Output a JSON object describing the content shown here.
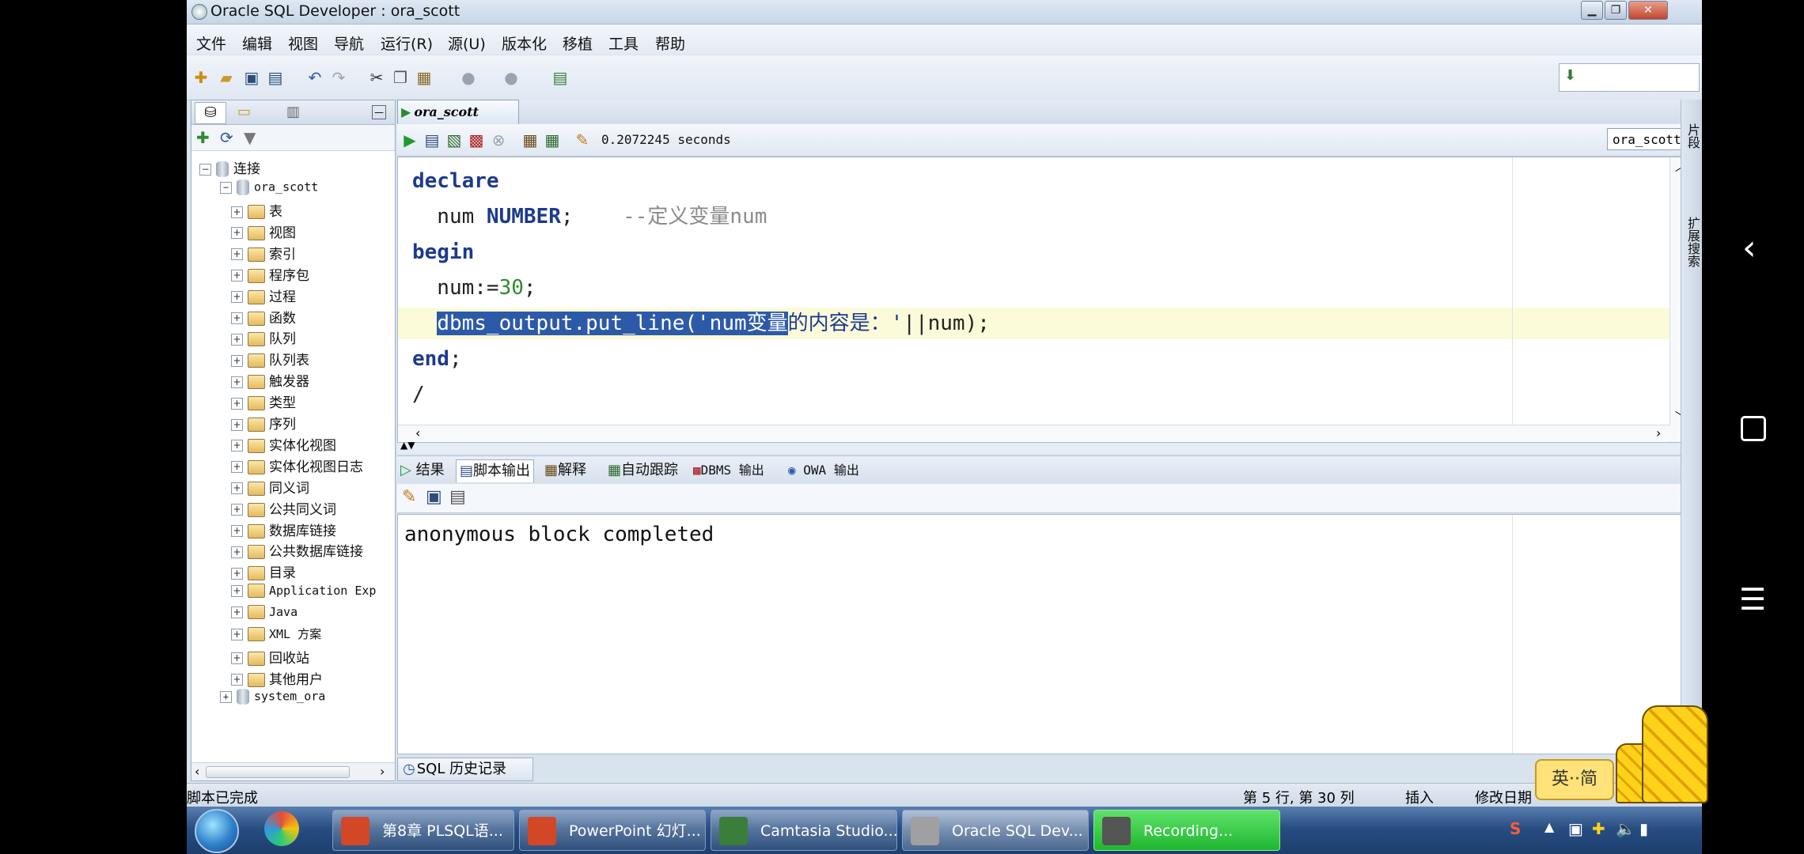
{
  "window": {
    "title": "Oracle SQL Developer : ora_scott"
  },
  "menu": [
    "文件",
    "编辑",
    "视图",
    "导航",
    "运行(R)",
    "源(U)",
    "版本化",
    "移植",
    "工具",
    "帮助"
  ],
  "tree": {
    "root": "连接",
    "connection": "ora_scott",
    "items": [
      "表",
      "视图",
      "索引",
      "程序包",
      "过程",
      "函数",
      "队列",
      "队列表",
      "触发器",
      "类型",
      "序列",
      "实体化视图",
      "实体化视图日志",
      "同义词",
      "公共同义词",
      "数据库链接",
      "公共数据库链接",
      "目录",
      "Application Exp",
      "Java",
      "XML 方案",
      "回收站",
      "其他用户"
    ],
    "other_connection": "system_ora"
  },
  "editor": {
    "tab_label": "ora_scott",
    "timing": "0.2072245 seconds",
    "connection_select": "ora_scott",
    "code": {
      "l1_kw": "declare",
      "l2_ident": "  num ",
      "l2_type": "NUMBER",
      "l2_semi": ";    ",
      "l2_comment": "--定义变量num",
      "l3_kw": "begin",
      "l4_ident": "  num:=",
      "l4_num": "30",
      "l4_semi": ";",
      "l5_indent": "  ",
      "l5_selected": "dbms_output.put_line('num变量",
      "l5_string_rest": "的内容是：'",
      "l5_rest": "||num);",
      "l6_kw": "end",
      "l6_semi": ";",
      "l7": "/"
    }
  },
  "output_tabs": [
    "结果",
    "脚本输出",
    "解释",
    "自动跟踪",
    "DBMS 输出",
    "OWA 输出"
  ],
  "output": {
    "text": "anonymous block completed"
  },
  "history_tab": "SQL 历史记录",
  "right_strip": [
    "片段",
    "扩展搜索"
  ],
  "status": {
    "left": "脚本已完成",
    "position": "第 5 行, 第 30 列",
    "mode": "插入",
    "date": "修改日期"
  },
  "ime": "英··简",
  "taskbar": [
    {
      "label": "第8章 PLSQL语...",
      "color": "#d24726"
    },
    {
      "label": "PowerPoint 幻灯...",
      "color": "#d24726"
    },
    {
      "label": "Camtasia Studio...",
      "color": "#3b7d3b"
    },
    {
      "label": "Oracle SQL Dev...",
      "color": "#a0a0a0"
    },
    {
      "label": "Recording...",
      "color": "#555555"
    }
  ]
}
